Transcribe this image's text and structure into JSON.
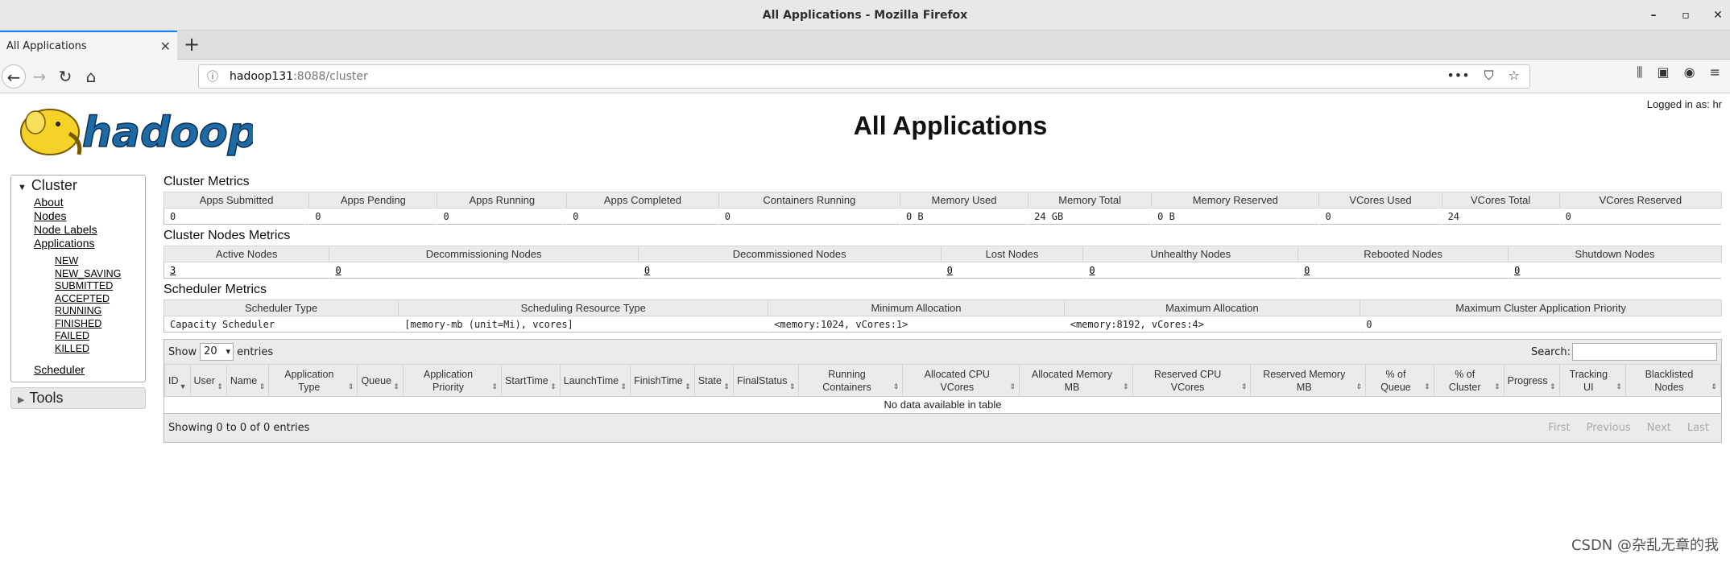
{
  "window": {
    "title": "All Applications - Mozilla Firefox",
    "minimize": "–",
    "maximize": "▫",
    "close": "✕"
  },
  "tab": {
    "label": "All Applications",
    "close": "✕",
    "new_tab": "+"
  },
  "nav": {
    "back": "←",
    "forward": "→",
    "reload": "↻",
    "home": "⌂"
  },
  "url": {
    "host": "hadoop131",
    "path": ":8088/cluster",
    "info": "ⓘ",
    "more": "•••",
    "pocket": "⛉",
    "star": "☆"
  },
  "toolbar": {
    "library": "⫼",
    "sidebar": "▣",
    "account": "◉",
    "menu": "≡"
  },
  "page": {
    "logged_in": "Logged in as: hr",
    "title": "All Applications",
    "logo_text": "hadoop"
  },
  "sidebar": {
    "cluster": "Cluster",
    "links": [
      "About",
      "Nodes",
      "Node Labels",
      "Applications"
    ],
    "app_states": [
      "NEW",
      "NEW_SAVING",
      "SUBMITTED",
      "ACCEPTED",
      "RUNNING",
      "FINISHED",
      "FAILED",
      "KILLED"
    ],
    "scheduler": "Scheduler",
    "tools": "Tools"
  },
  "cluster_metrics": {
    "title": "Cluster Metrics",
    "headers": [
      "Apps Submitted",
      "Apps Pending",
      "Apps Running",
      "Apps Completed",
      "Containers Running",
      "Memory Used",
      "Memory Total",
      "Memory Reserved",
      "VCores Used",
      "VCores Total",
      "VCores Reserved"
    ],
    "values": [
      "0",
      "0",
      "0",
      "0",
      "0",
      "0 B",
      "24 GB",
      "0 B",
      "0",
      "24",
      "0"
    ]
  },
  "node_metrics": {
    "title": "Cluster Nodes Metrics",
    "headers": [
      "Active Nodes",
      "Decommissioning Nodes",
      "Decommissioned Nodes",
      "Lost Nodes",
      "Unhealthy Nodes",
      "Rebooted Nodes",
      "Shutdown Nodes"
    ],
    "values": [
      "3",
      "0",
      "0",
      "0",
      "0",
      "0",
      "0"
    ]
  },
  "scheduler_metrics": {
    "title": "Scheduler Metrics",
    "headers": [
      "Scheduler Type",
      "Scheduling Resource Type",
      "Minimum Allocation",
      "Maximum Allocation",
      "Maximum Cluster Application Priority"
    ],
    "values": [
      "Capacity Scheduler",
      "[memory-mb (unit=Mi), vcores]",
      "<memory:1024, vCores:1>",
      "<memory:8192, vCores:4>",
      "0"
    ]
  },
  "apps_table": {
    "show_label": "Show",
    "show_value": "20",
    "entries_label": "entries",
    "search_label": "Search:",
    "columns": [
      "ID",
      "User",
      "Name",
      "Application Type",
      "Queue",
      "Application Priority",
      "StartTime",
      "LaunchTime",
      "FinishTime",
      "State",
      "FinalStatus",
      "Running Containers",
      "Allocated CPU VCores",
      "Allocated Memory MB",
      "Reserved CPU VCores",
      "Reserved Memory MB",
      "% of Queue",
      "% of Cluster",
      "Progress",
      "Tracking UI",
      "Blacklisted Nodes"
    ],
    "empty": "No data available in table",
    "info": "Showing 0 to 0 of 0 entries",
    "pager": [
      "First",
      "Previous",
      "Next",
      "Last"
    ]
  },
  "watermark": "CSDN @杂乱无章的我"
}
